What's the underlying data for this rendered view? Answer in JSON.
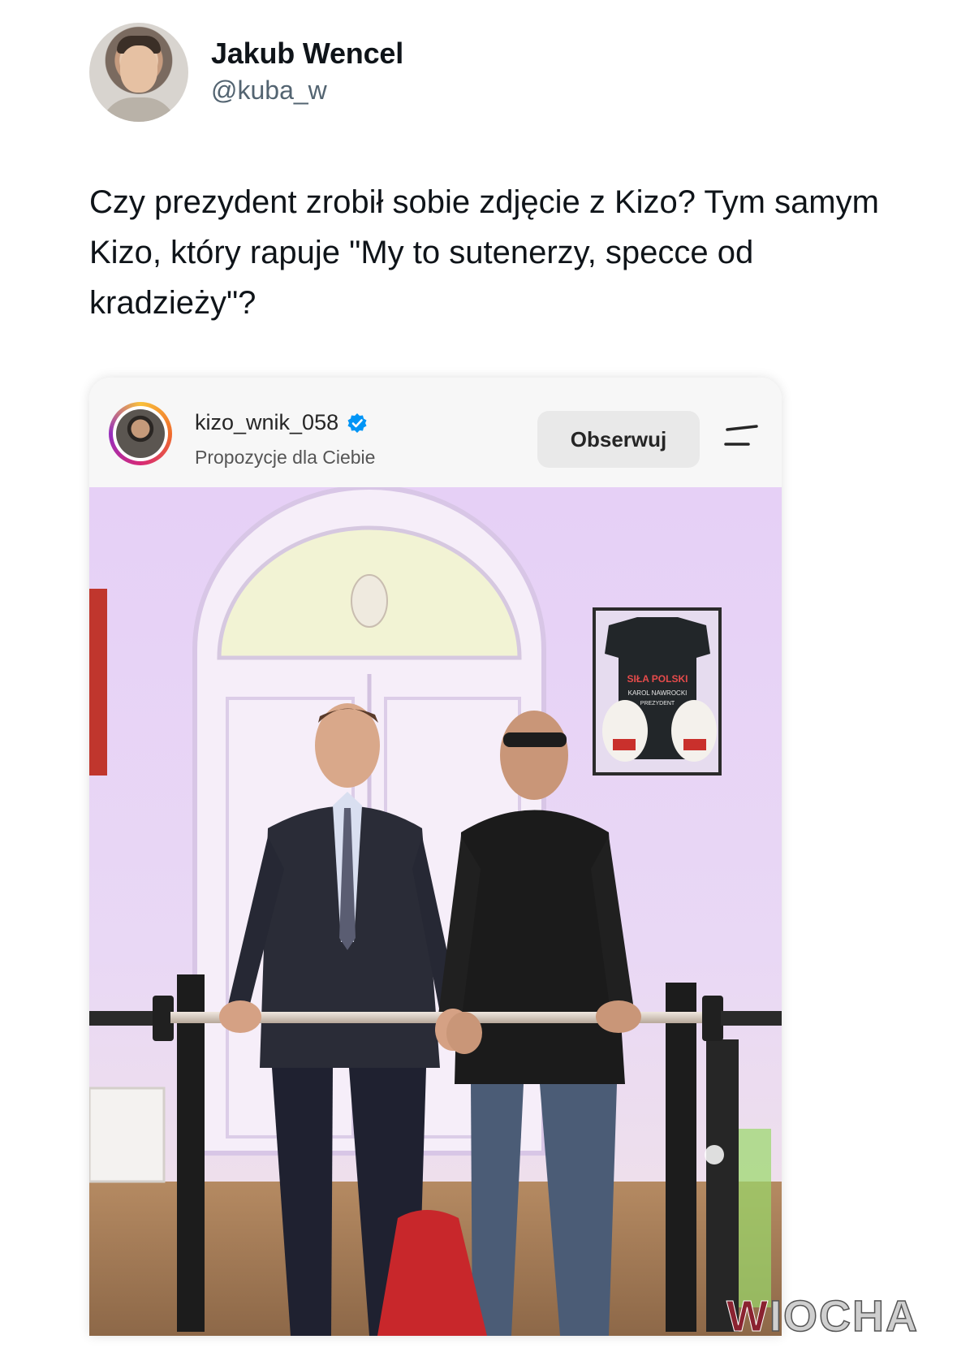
{
  "tweet": {
    "display_name": "Jakub Wencel",
    "handle": "@kuba_w",
    "text": "Czy prezydent zrobił sobie zdjęcie z Kizo? Tym samym Kizo, który rapuje \"My to sutenerzy, specce od kradzieży\"?"
  },
  "instagram_post": {
    "username": "kizo_wnik_058",
    "subtitle": "Propozycje dla Ciebie",
    "follow_label": "Obserwuj",
    "verified_icon": "verified-badge-icon",
    "menu_icon": "menu-icon",
    "photo_text": {
      "shirt_line1": "SIŁA POLSKI",
      "shirt_line2": "KAROL NAWROCKI",
      "shirt_line3": "PREZYDENT"
    }
  },
  "watermark": {
    "first_letter": "W",
    "rest": "IOCHA"
  },
  "colors": {
    "verified_blue": "#0095f6",
    "follow_bg": "#e9e9e9",
    "photo_lilac": "#e6d4f6"
  }
}
